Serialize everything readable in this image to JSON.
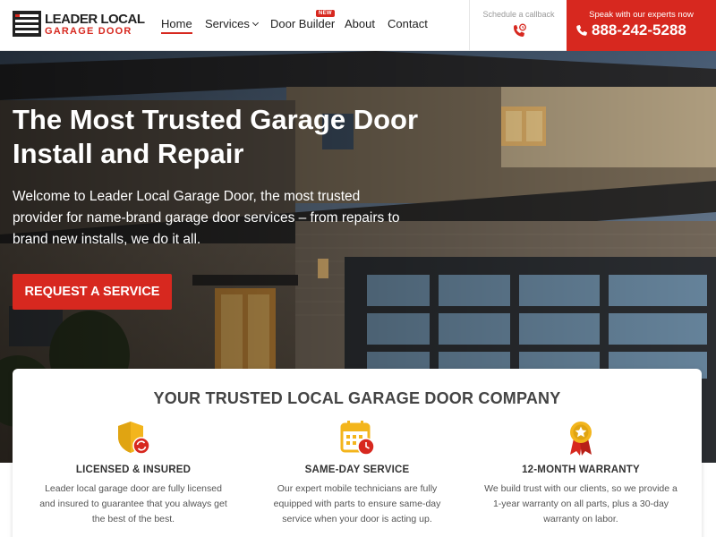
{
  "brand": {
    "name_line1": "LEADER LOCAL",
    "name_line2": "GARAGE DOOR"
  },
  "nav": {
    "items": [
      {
        "label": "Home"
      },
      {
        "label": "Services"
      },
      {
        "label": "Door Builder"
      },
      {
        "label": "About"
      },
      {
        "label": "Contact"
      }
    ],
    "new_badge": "NEW"
  },
  "callback": {
    "label": "Schedule a callback"
  },
  "phone": {
    "label": "Speak with our experts now",
    "number": "888-242-5288"
  },
  "hero": {
    "title": "The Most Trusted Garage Door Install and Repair",
    "description": "Welcome to Leader Local Garage Door, the most trusted provider for name-brand garage door services – from repairs to brand new installs, we do it all.",
    "cta": "REQUEST A SERVICE"
  },
  "features": {
    "heading": "YOUR TRUSTED LOCAL GARAGE DOOR COMPANY",
    "items": [
      {
        "icon": "shield-icon",
        "title": "LICENSED & INSURED",
        "text": "Leader local garage door are fully licensed and insured to guarantee that you always get the best of the best."
      },
      {
        "icon": "calendar-clock-icon",
        "title": "SAME-DAY SERVICE",
        "text": "Our expert mobile technicians are fully equipped with parts to ensure same-day service when your door is acting up."
      },
      {
        "icon": "award-medal-icon",
        "title": "12-MONTH WARRANTY",
        "text": "We build trust with our clients, so we provide a 1-year warranty on all parts, plus a 30-day warranty on labor."
      }
    ]
  },
  "colors": {
    "accent": "#d7281f",
    "icon_yellow": "#f3b51c",
    "text_dark": "#222222"
  }
}
